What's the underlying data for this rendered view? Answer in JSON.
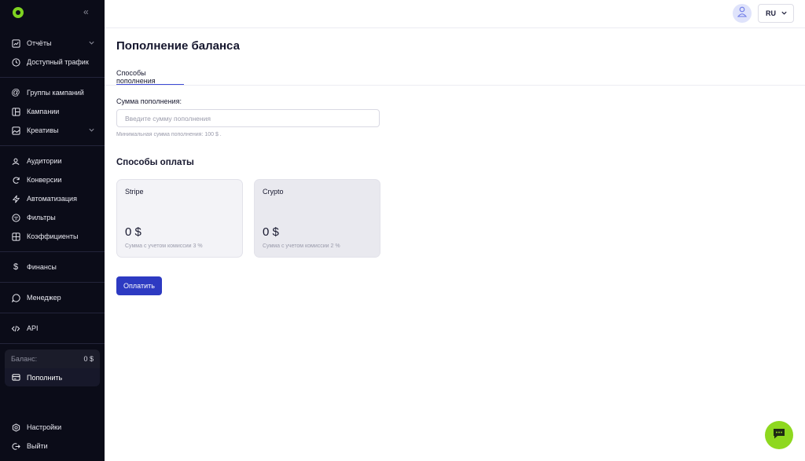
{
  "sidebar": {
    "collapse_icon": "double-chevron-left-icon",
    "items": [
      {
        "label": "Отчёты",
        "icon": "chart-icon"
      },
      {
        "label": "Доступный трафик",
        "icon": "clock-icon"
      },
      {
        "label": "Группы кампаний",
        "icon": "at-icon"
      },
      {
        "label": "Кампании",
        "icon": "layout-icon"
      },
      {
        "label": "Креативы",
        "icon": "image-icon"
      },
      {
        "label": "Аудитории",
        "icon": "audience-icon"
      },
      {
        "label": "Конверсии",
        "icon": "refresh-icon"
      },
      {
        "label": "Автоматизация",
        "icon": "bolt-icon"
      },
      {
        "label": "Фильтры",
        "icon": "filter-icon"
      },
      {
        "label": "Коэффициенты",
        "icon": "grid-icon"
      },
      {
        "label": "Финансы",
        "icon": "dollar-icon"
      },
      {
        "label": "Менеджер",
        "icon": "chat-icon"
      },
      {
        "label": "API",
        "icon": "code-icon"
      },
      {
        "label": "Настройки",
        "icon": "settings-icon"
      },
      {
        "label": "Выйти",
        "icon": "logout-icon"
      }
    ],
    "balance_label": "Баланс:",
    "balance_value": "0 $",
    "topup_label": "Пополнить"
  },
  "header": {
    "language": "RU"
  },
  "main": {
    "title": "Пополнение баланса",
    "tab_label": "Способы пополнения",
    "amount_label": "Сумма пополнения:",
    "amount_placeholder": "Введите сумму пополнения",
    "amount_value": "",
    "min_hint": "Минимальная сумма пополнения: 100 $ .",
    "methods_title": "Способы оплаты",
    "methods": [
      {
        "name": "Stripe",
        "amount": "0 $",
        "fee": "Сумма с учетом комиссии 3 %"
      },
      {
        "name": "Crypto",
        "amount": "0 $",
        "fee": "Сумма с учетом комиссии 2 %"
      }
    ],
    "pay_button": "Оплатить"
  },
  "colors": {
    "sidebar_bg": "#0b0c18",
    "accent": "#2d3ac2",
    "brand_green": "#8ed81f"
  }
}
